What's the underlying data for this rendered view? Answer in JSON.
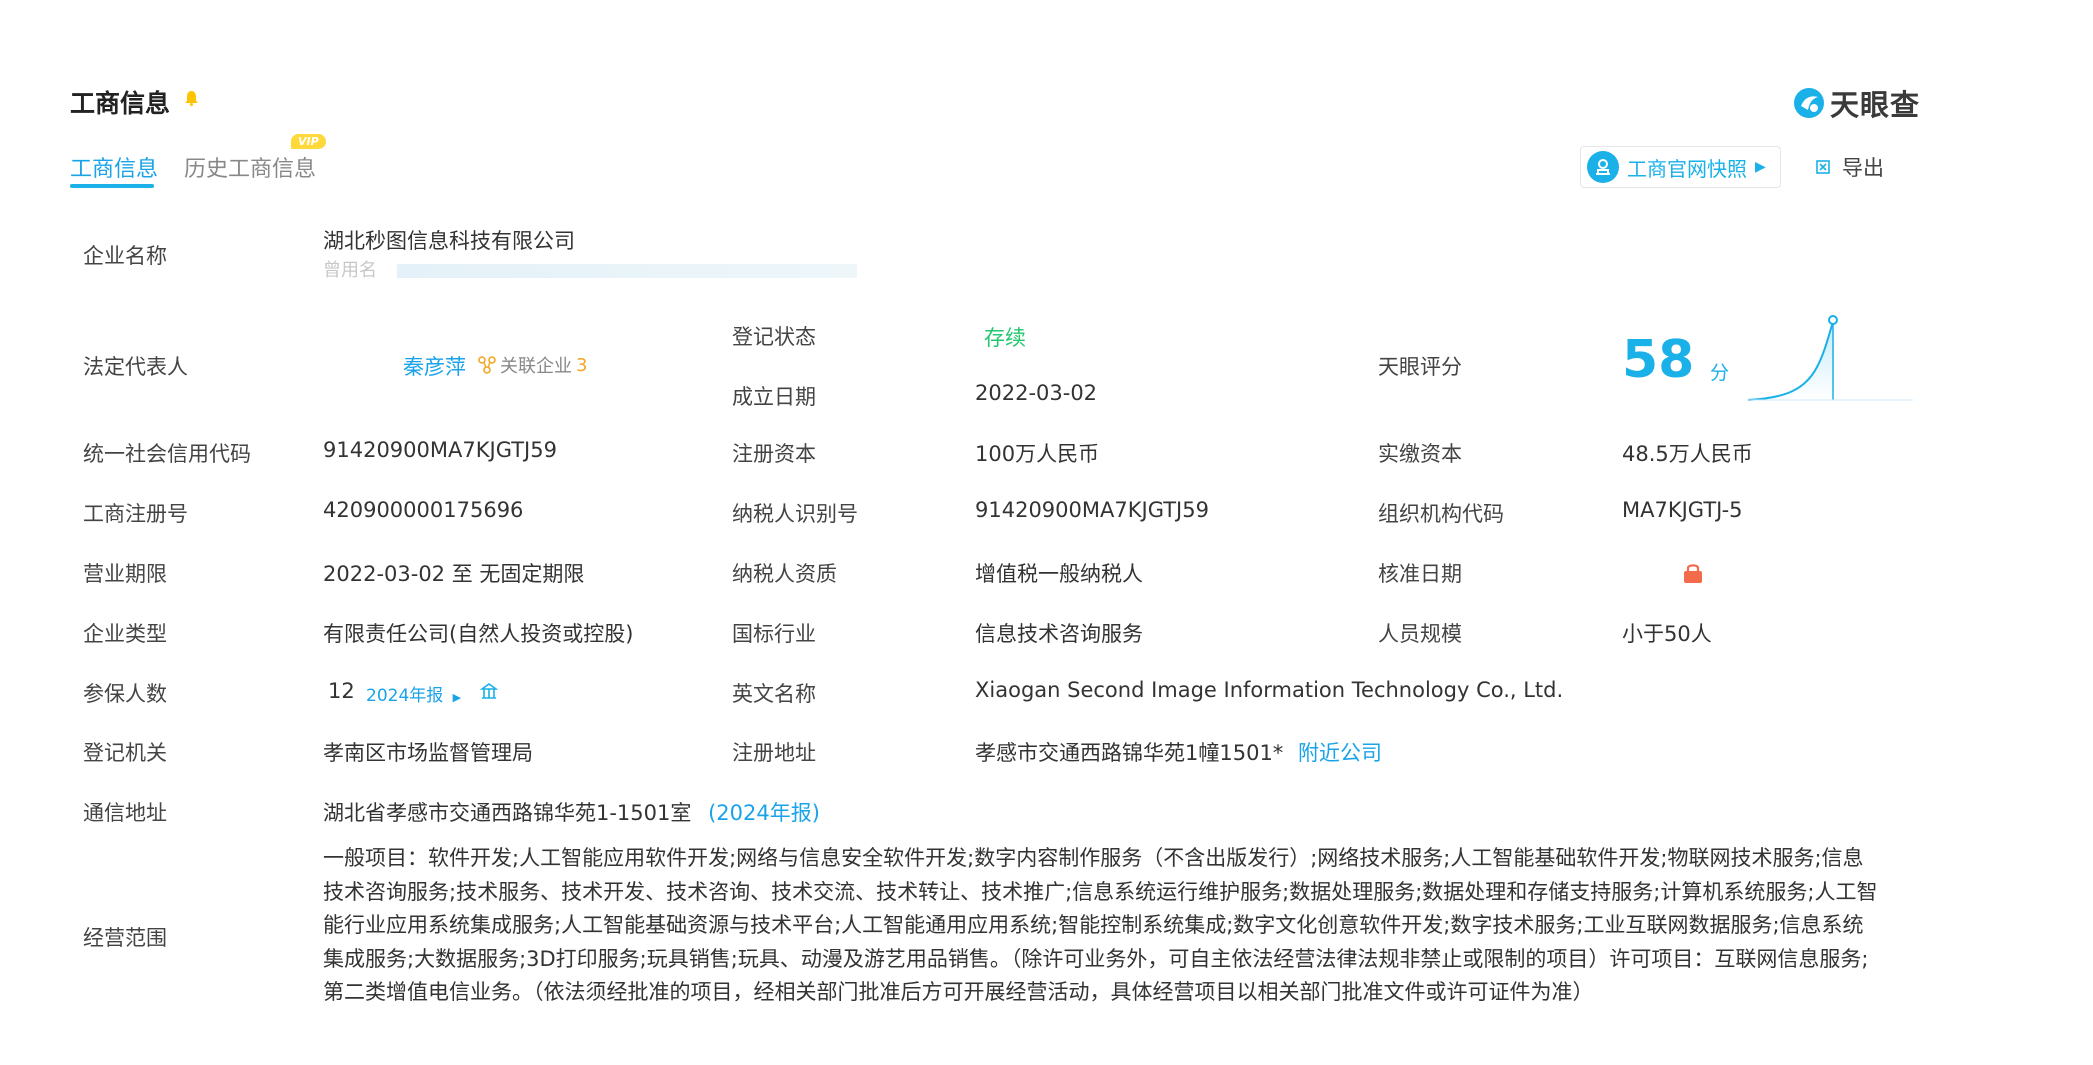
{
  "header": {
    "title": "工商信息",
    "brand": "天眼查"
  },
  "tabs": [
    {
      "label": "工商信息",
      "active": true
    },
    {
      "label": "历史工商信息",
      "badge": "VIP"
    }
  ],
  "actions": {
    "snapshot": "工商官网快照",
    "export": "导出"
  },
  "company": {
    "name_label": "企业名称",
    "name": "湖北秒图信息科技有限公司",
    "used_name_label": "曾用名",
    "used_name": ""
  },
  "legal_rep": {
    "label": "法定代表人",
    "name": "秦彦萍",
    "related": "关联企业",
    "related_count": "3"
  },
  "status": {
    "label": "登记状态",
    "value": "存续"
  },
  "established": {
    "label": "成立日期",
    "value": "2022-03-02"
  },
  "score": {
    "label": "天眼评分",
    "value": "58",
    "unit": "分"
  },
  "rows": [
    {
      "l1": "统一社会信用代码",
      "v1": "91420900MA7KJGTJ59",
      "l2": "注册资本",
      "v2": "100万人民币",
      "l3": "实缴资本",
      "v3": "48.5万人民币"
    },
    {
      "l1": "工商注册号",
      "v1": "420900000175696",
      "l2": "纳税人识别号",
      "v2": "91420900MA7KJGTJ59",
      "l3": "组织机构代码",
      "v3": "MA7KJGTJ-5"
    },
    {
      "l1": "营业期限",
      "v1": "2022-03-02 至 无固定期限",
      "l2": "纳税人资质",
      "v2": "增值税一般纳税人",
      "l3": "核准日期",
      "v3": ""
    },
    {
      "l1": "企业类型",
      "v1": "有限责任公司(自然人投资或控股)",
      "l2": "国标行业",
      "v2": "信息技术咨询服务",
      "l3": "人员规模",
      "v3": "小于50人"
    }
  ],
  "insured": {
    "label": "参保人数",
    "value": "12",
    "report": "2024年报"
  },
  "english_name": {
    "label": "英文名称",
    "value": "Xiaogan Second Image Information Technology Co., Ltd."
  },
  "authority": {
    "label": "登记机关",
    "value": "孝南区市场监督管理局"
  },
  "reg_address": {
    "label": "注册地址",
    "value": "孝感市交通西路锦华苑1幢1501*",
    "nearby": "附近公司"
  },
  "mail_address": {
    "label": "通信地址",
    "value": "湖北省孝感市交通西路锦华苑1-1501室",
    "report": "(2024年报)"
  },
  "scope": {
    "label": "经营范围",
    "text": "一般项目：软件开发;人工智能应用软件开发;网络与信息安全软件开发;数字内容制作服务（不含出版发行）;网络技术服务;人工智能基础软件开发;物联网技术服务;信息技术咨询服务;技术服务、技术开发、技术咨询、技术交流、技术转让、技术推广;信息系统运行维护服务;数据处理服务;数据处理和存储支持服务;计算机系统服务;人工智能行业应用系统集成服务;人工智能基础资源与技术平台;人工智能通用应用系统;智能控制系统集成;数字文化创意软件开发;数字技术服务;工业互联网数据服务;信息系统集成服务;大数据服务;3D打印服务;玩具销售;玩具、动漫及游艺用品销售。（除许可业务外，可自主依法经营法律法规非禁止或限制的项目）许可项目：互联网信息服务;第二类增值电信业务。（依法须经批准的项目，经相关部门批准后方可开展经营活动，具体经营项目以相关部门批准文件或许可证件为准）"
  },
  "colors": {
    "accent": "#1ab0e8",
    "status": "#24c76f",
    "lock": "#f26b4a",
    "bell": "#ffc400"
  },
  "icons": [
    "bell-icon",
    "tianyancha-logo",
    "user-stamp-icon",
    "export-icon",
    "related-network-icon",
    "lock-icon",
    "chart-icon"
  ]
}
